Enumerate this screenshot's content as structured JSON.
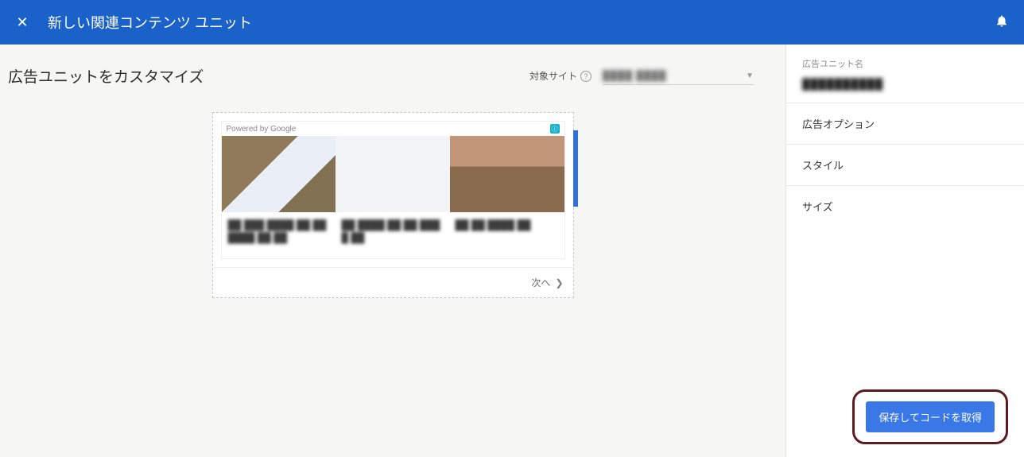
{
  "header": {
    "title": "新しい関連コンテンツ ユニット"
  },
  "main": {
    "heading": "広告ユニットをカスタマイズ",
    "target_site_label": "対象サイト",
    "target_site_value": "████ ████",
    "next_label": "次へ"
  },
  "preview": {
    "powered_by": "Powered by Google",
    "captions": [
      "██ ███ ████ ██ ██████ ██ ██",
      "██ ████ ██ ██ ████ ██",
      "██ ██ ████ ██"
    ]
  },
  "sidebar": {
    "unit_name_label": "広告ユニット名",
    "unit_name_value": "██████████",
    "rows": {
      "options": "広告オプション",
      "style": "スタイル",
      "size": "サイズ"
    },
    "save_label": "保存してコードを取得"
  }
}
